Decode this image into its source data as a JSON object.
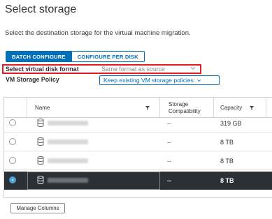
{
  "title": "Select storage",
  "subtitle": "Select the destination storage for the virtual machine migration.",
  "tabs": [
    {
      "label": "BATCH CONFIGURE",
      "active": true
    },
    {
      "label": "CONFIGURE PER DISK",
      "active": false
    }
  ],
  "disk_format": {
    "label": "Select virtual disk format",
    "value": "Same format as source"
  },
  "storage_policy": {
    "label": "VM Storage Policy",
    "value": "Keep existing VM storage policies"
  },
  "table": {
    "columns": [
      {
        "label": "Name"
      },
      {
        "label_line1": "Storage",
        "label_line2": "Compatibility"
      },
      {
        "label": "Capacity"
      }
    ],
    "rows": [
      {
        "compatibility": "--",
        "capacity": "319 GB",
        "selected": false
      },
      {
        "compatibility": "--",
        "capacity": "8 TB",
        "selected": false
      },
      {
        "compatibility": "--",
        "capacity": "8 TB",
        "selected": false
      },
      {
        "compatibility": "--",
        "capacity": "8 TB",
        "selected": true
      }
    ]
  },
  "manage_columns_label": "Manage Columns",
  "colors": {
    "accent": "#0070b8",
    "highlight": "#e31b23",
    "selected_row": "#2b3034",
    "radio_selected": "#4aa3df"
  },
  "icons": [
    "filter-icon",
    "datastore-icon",
    "chevron-down-icon"
  ]
}
